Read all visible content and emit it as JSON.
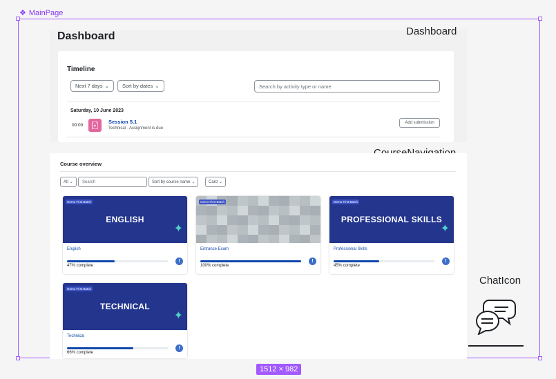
{
  "frame": {
    "label": "MainPage",
    "size": "1512 × 982"
  },
  "annotations": {
    "dashboard": "Dashboard",
    "course_navigation": "CourseNavigation",
    "chat_icon": "ChatIcon"
  },
  "dashboard": {
    "title": "Dashboard",
    "timeline": {
      "title": "Timeline",
      "filter_days": "Next 7 days",
      "sort": "Sort by dates",
      "search_placeholder": "Search by activity type or name",
      "date": "Saturday, 10 June 2023",
      "event": {
        "time": "00:00",
        "name": "Session 5.1",
        "detail": "Technical · Assignment is due",
        "action": "Add submission"
      }
    }
  },
  "course_overview": {
    "title": "Course overview",
    "filter": "All",
    "search_placeholder": "Search",
    "sort": "Sort by course name",
    "view": "Card",
    "courses": [
      {
        "banner": "ENGLISH",
        "tag": "Gemo First Batch",
        "name": "English",
        "progress": 47,
        "progress_text": "47% complete"
      },
      {
        "banner": "",
        "tag": "Gemo First Batch",
        "name": "Entrance Exam",
        "progress": 100,
        "progress_text": "100% complete"
      },
      {
        "banner": "PROFESSIONAL SKILLS",
        "tag": "Gemo First Batch",
        "name": "Professional Skills",
        "progress": 45,
        "progress_text": "45% complete"
      },
      {
        "banner": "TECHNICAL",
        "tag": "Gemo First Batch",
        "name": "Technical",
        "progress": 66,
        "progress_text": "66% complete"
      }
    ]
  },
  "colors": {
    "accent": "#0f47ad",
    "banner": "#23358d",
    "frame": "#a259ff",
    "assignment_icon": "#e3669f"
  }
}
